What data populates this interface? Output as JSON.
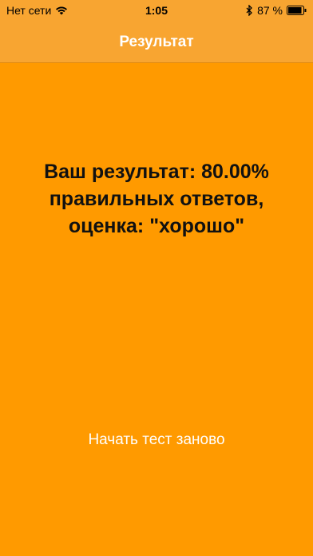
{
  "status_bar": {
    "carrier": "Нет сети",
    "time": "1:05",
    "battery": "87 %",
    "icons": [
      "wifi-icon",
      "bluetooth-icon",
      "battery-icon"
    ]
  },
  "nav": {
    "title": "Результат"
  },
  "main": {
    "result_text": "Ваш результат: 80.00% правильных ответов, оценка: \"хорошо\"",
    "restart_label": "Начать тест заново"
  },
  "colors": {
    "background": "#FF9A00",
    "nav_background": "#F8A531",
    "nav_title": "#FFFFFF",
    "result_text": "#111111",
    "button_text": "#FFFFFF"
  }
}
